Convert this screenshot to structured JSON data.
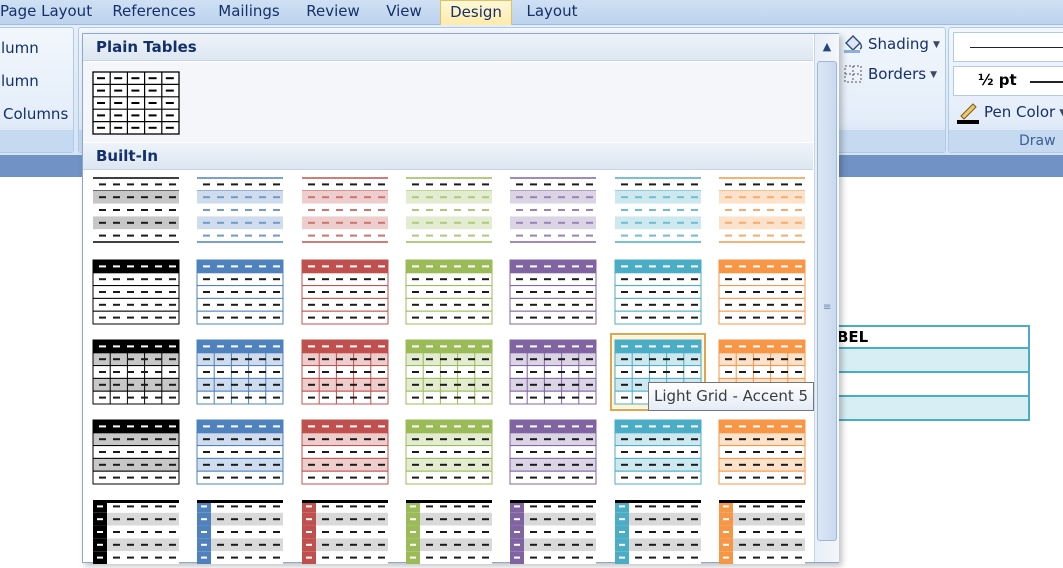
{
  "tabs": [
    {
      "label": "Page Layout",
      "active": false
    },
    {
      "label": "References",
      "active": false
    },
    {
      "label": "Mailings",
      "active": false
    },
    {
      "label": "Review",
      "active": false
    },
    {
      "label": "View",
      "active": false
    },
    {
      "label": "Design",
      "active": true
    },
    {
      "label": "Layout",
      "active": false
    }
  ],
  "ribbon": {
    "left_group_items": [
      "lumn",
      "lumn",
      "Columns"
    ],
    "shading_label": "Shading",
    "borders_label": "Borders",
    "pen_weight": "½ pt",
    "pen_color_label": "Pen Color",
    "draw_group_label": "Draw"
  },
  "gallery": {
    "plain_header": "Plain Tables",
    "builtin_header": "Built-In",
    "tooltip": "Light Grid - Accent 5",
    "selected_style": "Light Grid - Accent 5",
    "accent_colors": [
      "#000000",
      "#4f81bd",
      "#c0504d",
      "#9bbb59",
      "#8064a2",
      "#4bacc6",
      "#f79646"
    ],
    "row_styles": [
      "light-shading",
      "light-list",
      "light-grid",
      "medium-shading-1",
      "medium-shading-2"
    ]
  },
  "document": {
    "table_first_cell": "BEL"
  },
  "colors": {
    "ribbon_bg": "#d6e4f5",
    "active_tab": "#ffeaa8",
    "selection_border": "#e5a44a"
  }
}
